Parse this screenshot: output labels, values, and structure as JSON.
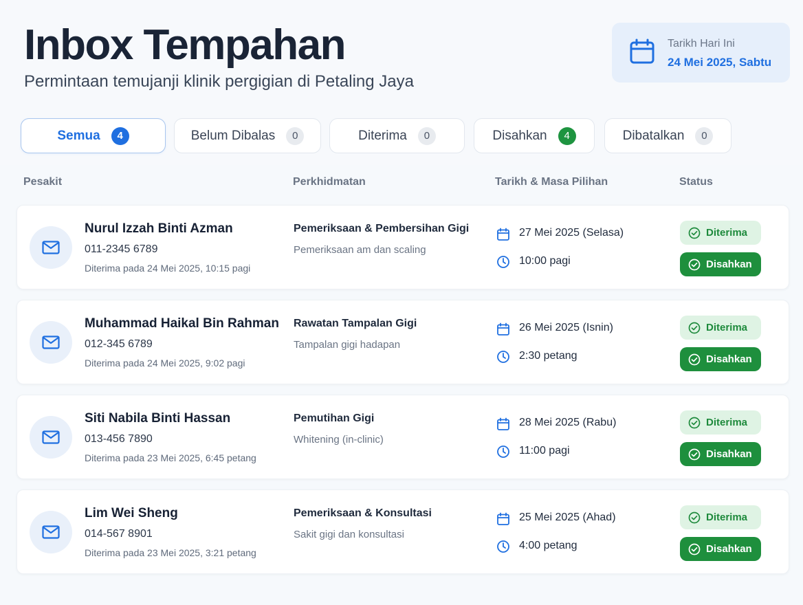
{
  "header": {
    "title": "Inbox Tempahan",
    "subtitle": "Permintaan temujanji klinik pergigian di Petaling Jaya",
    "today_label": "Tarikh Hari Ini",
    "today_value": "24 Mei 2025, Sabtu"
  },
  "tabs": [
    {
      "label": "Semua",
      "count": "4"
    },
    {
      "label": "Belum Dibalas",
      "count": "0"
    },
    {
      "label": "Diterima",
      "count": "0"
    },
    {
      "label": "Disahkan",
      "count": "4"
    },
    {
      "label": "Dibatalkan",
      "count": "0"
    }
  ],
  "columns": {
    "patient": "Pesakit",
    "service": "Perkhidmatan",
    "datetime": "Tarikh & Masa Pilihan",
    "status": "Status"
  },
  "bookings": [
    {
      "name": "Nurul Izzah Binti Azman",
      "phone": "011-2345 6789",
      "received": "Diterima pada 24 Mei 2025, 10:15 pagi",
      "service": "Pemeriksaan & Pembersihan Gigi",
      "service_desc": "Pemeriksaan am dan scaling",
      "date": "27 Mei 2025 (Selasa)",
      "time": "10:00 pagi",
      "status_accepted": "Diterima",
      "status_confirmed": "Disahkan"
    },
    {
      "name": "Muhammad Haikal Bin Rahman",
      "phone": "012-345 6789",
      "received": "Diterima pada 24 Mei 2025, 9:02 pagi",
      "service": "Rawatan Tampalan Gigi",
      "service_desc": "Tampalan gigi hadapan",
      "date": "26 Mei 2025 (Isnin)",
      "time": "2:30 petang",
      "status_accepted": "Diterima",
      "status_confirmed": "Disahkan"
    },
    {
      "name": "Siti Nabila Binti Hassan",
      "phone": "013-456 7890",
      "received": "Diterima pada 23 Mei 2025, 6:45 petang",
      "service": "Pemutihan Gigi",
      "service_desc": "Whitening (in-clinic)",
      "date": "28 Mei 2025 (Rabu)",
      "time": "11:00 pagi",
      "status_accepted": "Diterima",
      "status_confirmed": "Disahkan"
    },
    {
      "name": "Lim Wei Sheng",
      "phone": "014-567 8901",
      "received": "Diterima pada 23 Mei 2025, 3:21 petang",
      "service": "Pemeriksaan & Konsultasi",
      "service_desc": "Sakit gigi dan konsultasi",
      "date": "25 Mei 2025 (Ahad)",
      "time": "4:00 petang",
      "status_accepted": "Diterima",
      "status_confirmed": "Disahkan"
    }
  ],
  "colors": {
    "accent": "#1f6fe0",
    "success": "#1e8f3d",
    "success_light": "#dff3e4"
  },
  "icons": {
    "today": "calendar-icon",
    "patient": "mail-icon",
    "date": "calendar-icon",
    "time": "clock-icon",
    "status": "check-circle-icon"
  }
}
